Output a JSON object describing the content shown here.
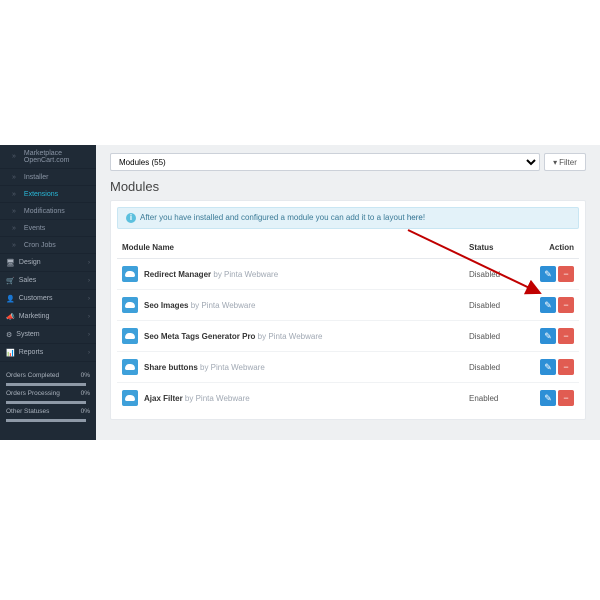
{
  "sidebar": {
    "sub_items": [
      {
        "label": "Marketplace OpenCart.com",
        "active": false
      },
      {
        "label": "Installer",
        "active": false
      },
      {
        "label": "Extensions",
        "active": true
      },
      {
        "label": "Modifications",
        "active": false
      },
      {
        "label": "Events",
        "active": false
      },
      {
        "label": "Cron Jobs",
        "active": false
      }
    ],
    "top_items": [
      {
        "label": "Design",
        "icon": "desktop-icon"
      },
      {
        "label": "Sales",
        "icon": "cart-icon"
      },
      {
        "label": "Customers",
        "icon": "user-icon"
      },
      {
        "label": "Marketing",
        "icon": "share-icon"
      },
      {
        "label": "System",
        "icon": "gear-icon"
      },
      {
        "label": "Reports",
        "icon": "chart-icon"
      }
    ],
    "stats": [
      {
        "label": "Orders Completed",
        "value": "0%"
      },
      {
        "label": "Orders Processing",
        "value": "0%"
      },
      {
        "label": "Other Statuses",
        "value": "0%"
      }
    ]
  },
  "filter": {
    "select_value": "Modules (55)",
    "button_label": "Filter"
  },
  "page": {
    "title": "Modules"
  },
  "alert": {
    "prefix": "After you have installed and configured a module you can add it to a layout ",
    "link": "here",
    "suffix": "!"
  },
  "table": {
    "col_name": "Module Name",
    "col_status": "Status",
    "col_action": "Action",
    "by_label": " by Pinta Webware",
    "rows": [
      {
        "name": "Redirect Manager",
        "status": "Disabled"
      },
      {
        "name": "Seo Images",
        "status": "Disabled"
      },
      {
        "name": "Seo Meta Tags Generator Pro",
        "status": "Disabled"
      },
      {
        "name": "Share buttons",
        "status": "Disabled"
      },
      {
        "name": "Ajax Filter",
        "status": "Enabled"
      }
    ]
  }
}
